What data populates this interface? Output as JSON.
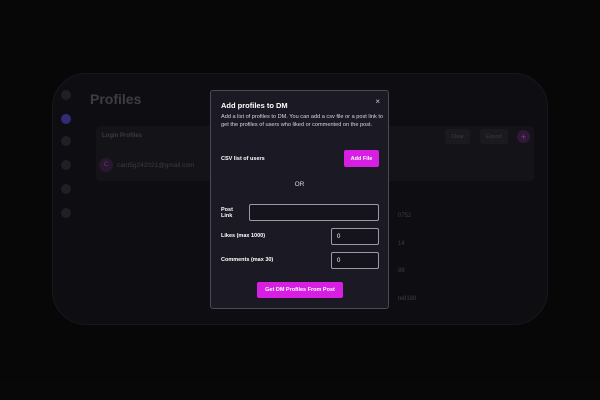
{
  "app": {
    "title": "Profiles",
    "panel_label": "Login Profiles",
    "account": {
      "avatar_letter": "C",
      "email": "cant5g242021@gmail.com"
    },
    "clear_label": "Clear",
    "export_label": "Export",
    "add_label": "+",
    "ids": [
      "0752",
      "14",
      "88",
      "te8188"
    ]
  },
  "modal": {
    "title": "Add profiles to DM",
    "close_glyph": "×",
    "description": "Add a list of profiles to DM. You can add a csv file or a post link to get the profiles of users who liked or commented on the post.",
    "csv_label": "CSV list of users",
    "add_file_label": "Add File",
    "or_label": "OR",
    "post_link_label_1": "Post",
    "post_link_label_2": "Link",
    "post_link_value": "",
    "likes_label": "Likes (max 1000)",
    "likes_value": "0",
    "comments_label": "Comments (max 30)",
    "comments_value": "0",
    "submit_label": "Get DM Profiles From Post"
  },
  "colors": {
    "accent": "#d61fe3",
    "modal_bg": "#1b1a24",
    "page_bg": "#0e0e10"
  }
}
